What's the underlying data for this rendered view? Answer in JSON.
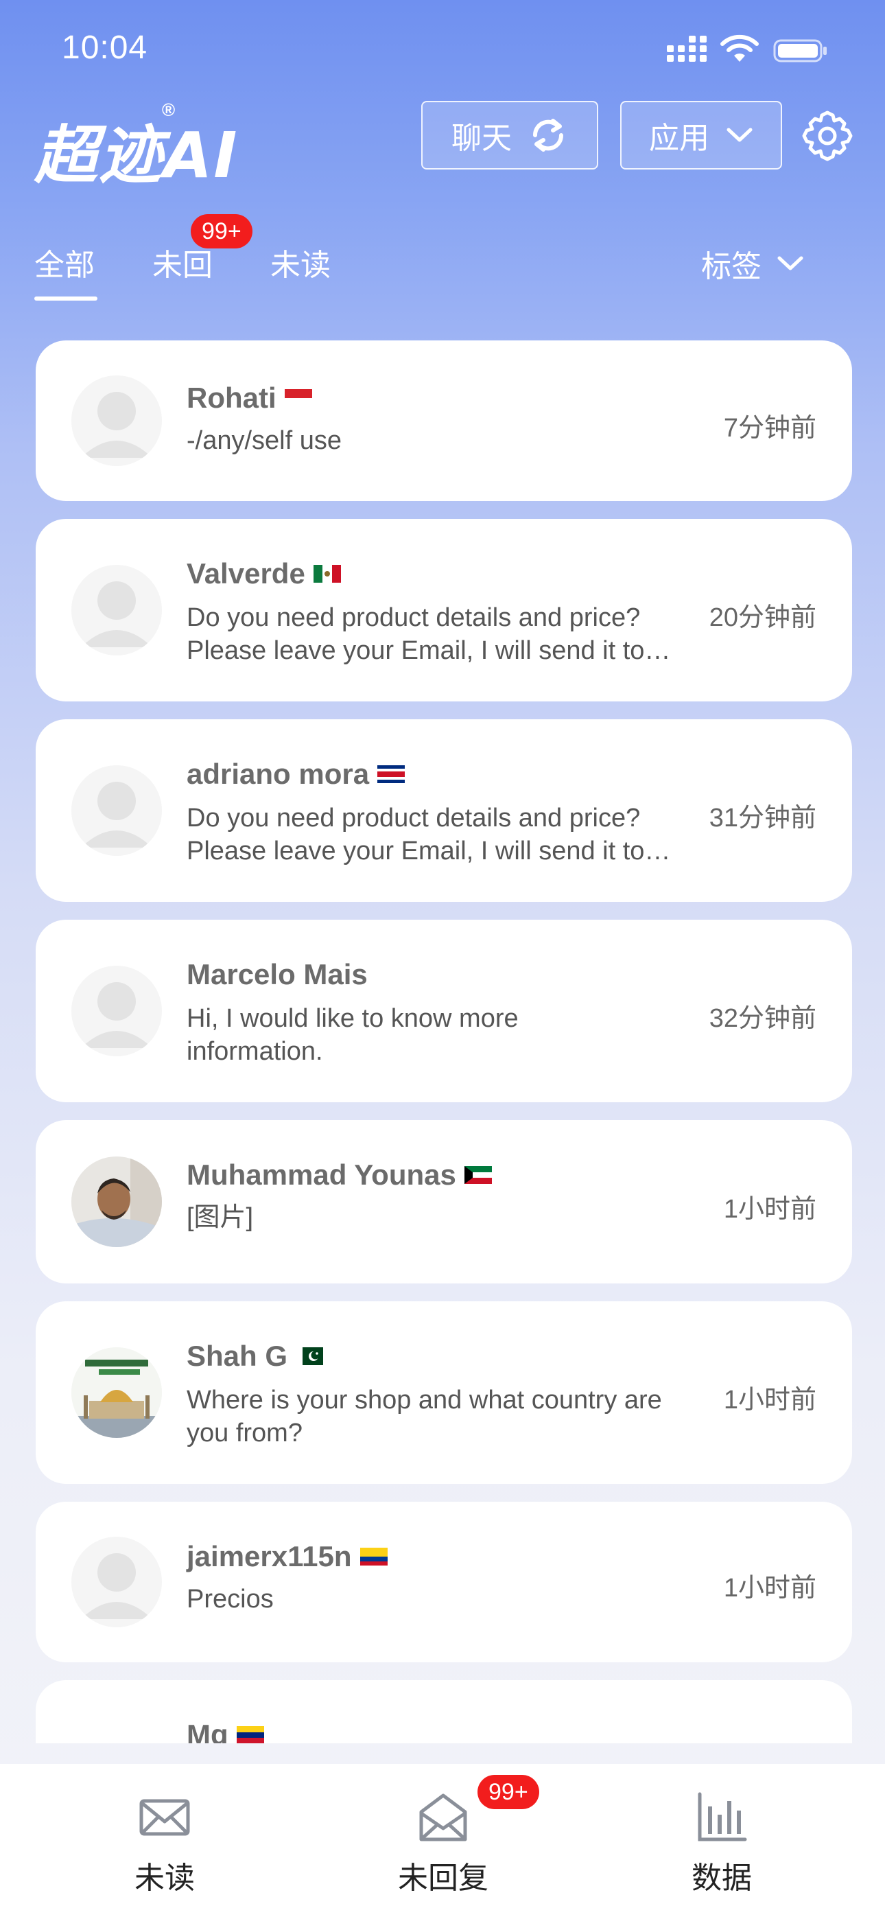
{
  "status_bar": {
    "time": "10:04"
  },
  "header": {
    "logo_text": "超迹AI",
    "logo_mark": "®",
    "chat_button": "聊天",
    "app_button": "应用"
  },
  "tabs": {
    "all": "全部",
    "no_reply": "未回",
    "unread": "未读",
    "no_reply_badge": "99+",
    "tag_filter": "标签"
  },
  "conversations": [
    {
      "name": "Rohati",
      "flag": "indonesia-flag",
      "message_lines": [
        "-/any/self use"
      ],
      "time": "7分钟前",
      "avatar": "default-avatar"
    },
    {
      "name": "Valverde",
      "flag": "mexico-flag",
      "message_lines": [
        "Do you need product details and price?",
        "Please leave your Email, I will send it to…"
      ],
      "time": "20分钟前",
      "avatar": "default-avatar"
    },
    {
      "name": "adriano mora",
      "flag": "costa-rica-flag",
      "message_lines": [
        "Do you need product details and price?",
        "Please leave your Email, I will send it to…"
      ],
      "time": "31分钟前",
      "avatar": "default-avatar"
    },
    {
      "name": "Marcelo Mais",
      "flag": "",
      "message_lines": [
        "Hi, I would like to know more",
        "information."
      ],
      "time": "32分钟前",
      "avatar": "default-avatar"
    },
    {
      "name": "Muhammad Younas",
      "flag": "kuwait-flag",
      "message_lines": [
        "[图片]"
      ],
      "time": "1小时前",
      "avatar": "photo-avatar-man"
    },
    {
      "name": "Shah G",
      "flag": "pakistan-flag",
      "message_lines": [
        "Where is your shop and what country are",
        "you from?"
      ],
      "time": "1小时前",
      "avatar": "photo-avatar-mosque"
    },
    {
      "name": "jaimerx115n",
      "flag": "colombia-flag",
      "message_lines": [
        "Precios"
      ],
      "time": "1小时前",
      "avatar": "default-avatar"
    },
    {
      "name": "Mg",
      "flag": "venezuela-flag",
      "message_lines": [],
      "time": "",
      "avatar": "default-avatar"
    }
  ],
  "bottom_nav": {
    "unread": "未读",
    "no_reply": "未回复",
    "no_reply_badge": "99+",
    "data": "数据"
  },
  "colors": {
    "accent_badge": "#f21d1d",
    "header_gradient_top": "#6f90f0"
  }
}
